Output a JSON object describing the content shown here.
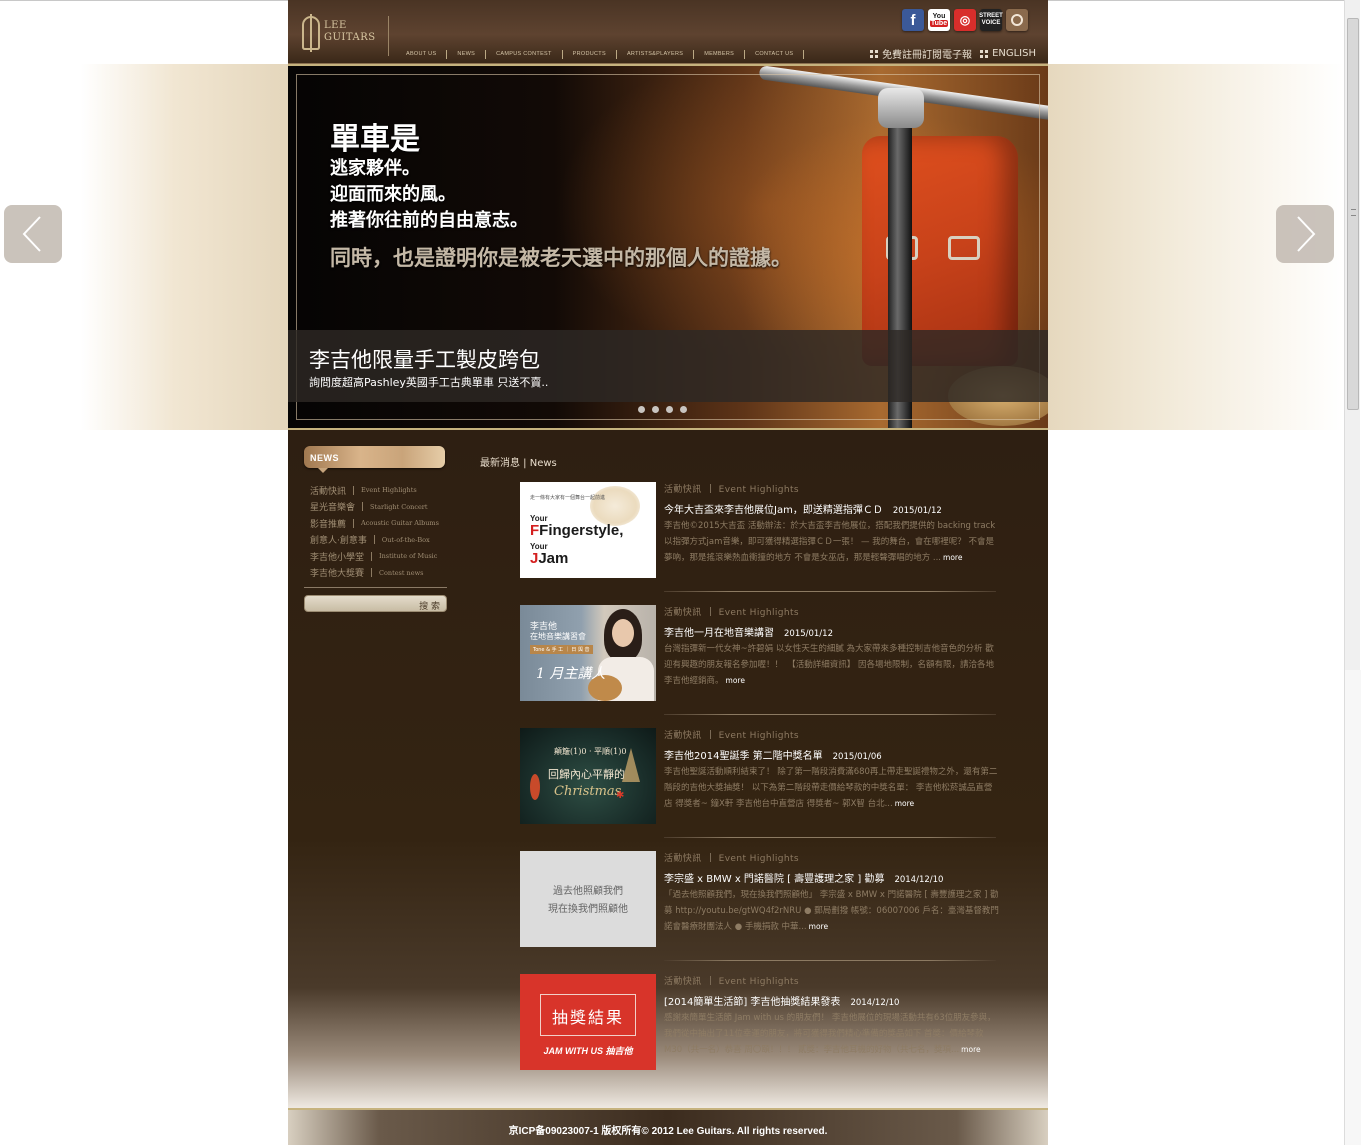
{
  "header": {
    "logo_text_line1": "LEE",
    "logo_text_line2": "GUITARS",
    "nav": [
      "ABOUT US",
      "NEWS",
      "CAMPUS CONTEST",
      "PRODUCTS",
      "ARTISTS&PLAYERS",
      "MEMBERS",
      "CONTACT US"
    ],
    "subscribe_label": "免費註冊訂閱電子報",
    "english_label": "ENGLISH",
    "social": [
      "facebook-icon",
      "youtube-icon",
      "weibo-icon",
      "streetvoice-icon",
      "instagram-icon"
    ],
    "youtube_label_1": "You",
    "youtube_label_2": "Tube",
    "streetvoice_label": "STREET VOICE"
  },
  "banner": {
    "line1": "單車是",
    "line2": "逃家夥伴。",
    "line3": "迎面而來的風。",
    "line4": "推著你往前的自由意志。",
    "line5": "同時，也是證明你是被老天選中的那個人的證據。",
    "caption_title": "李吉他限量手工製皮跨包",
    "caption_subtitle": "詢問度超高Pashley英國手工古典單車 只送不賣..",
    "slide_count": 4
  },
  "sidebar": {
    "tab_label": "NEWS",
    "items": [
      {
        "zh": "活動快訊",
        "en": "Event Highlights"
      },
      {
        "zh": "星光音樂會",
        "en": "Starlight Concert"
      },
      {
        "zh": "影音推薦",
        "en": "Acoustic Guitar Albums"
      },
      {
        "zh": "創意人‧創意事",
        "en": "Out-of-the-Box"
      },
      {
        "zh": "李吉他小學堂",
        "en": "Institute of Music"
      },
      {
        "zh": "李吉他大獎賽",
        "en": "Contest news"
      }
    ],
    "search_label": "搜 索"
  },
  "main": {
    "heading": "最新消息 | News",
    "more_label": "more",
    "items": [
      {
        "cat_zh": "活動快訊",
        "cat_en": "Event Highlights",
        "title": "今年大吉盃來李吉他展位Jam，即送精選指彈ＣＤ",
        "date": "2015/01/12",
        "body": "李吉他©2015大吉盃 活動辦法：於大吉盃李吉他展位，搭配我們提供的 backing track以指彈方式jam音樂，即可獲得精選指彈ＣＤ一張！ — 我的舞台，會在哪裡呢？ 不會是夢吶，那是搖滾樂熱血衝撞的地方 不會是女巫店，那是輕聲彈唱的地方 ...",
        "thumb": {
          "top": "走一條有大家有一個舞台一起前進",
          "your": "Your",
          "main1": "Fingerstyle,",
          "your2": "Your",
          "main2": "Jam"
        }
      },
      {
        "cat_zh": "活動快訊",
        "cat_en": "Event Highlights",
        "title": "李吉他一月在地音樂講習",
        "date": "2015/01/12",
        "body": "台灣指彈新一代女神~許碧娟 以女性天生的細膩 為大家帶來多種控制吉他音色的分析 歡迎有興趣的朋友報名參加喔！！　【活動詳細資訊】 因各場地限制，名額有限，請洽各地李吉他經銷商。",
        "thumb": {
          "a": "李吉他",
          "b": "在地音樂講習會",
          "c": "Tone & 手 工 ｜ 日 與 音",
          "d": "1 月主講人"
        }
      },
      {
        "cat_zh": "活動快訊",
        "cat_en": "Event Highlights",
        "title": "李吉他2014聖誕季 第二階中獎名單",
        "date": "2015/01/06",
        "body": "李吉他聖誕活動順利結束了！ 除了第一階段消費滿680再上帶走聖誕禮物之外，還有第二階段的吉他大獎抽獎！ 以下為第二階段帶走價給琴款的中獎名單： 李吉他松菸誠品直營店 得獎者~ 鐘X軒 李吉他台中直營店 得獎者~ 郭X智 台北...",
        "thumb": {
          "a": "顛簸(1)0 · 平順(1)0",
          "b": "回歸內心平靜的",
          "c": "Christmas"
        }
      },
      {
        "cat_zh": "活動快訊",
        "cat_en": "Event Highlights",
        "title": "李宗盛 x BMW x 門諾醫院 [ 壽豐護理之家 ] 勸募",
        "date": "2014/12/10",
        "body": "「過去他照顧我們，現在換我們照顧他」 李宗盛 x BMW x 門諾醫院 [ 壽豐護理之家 ] 勸募 http://youtu.be/gtWQ4f2rNRU ● 郵局劃撥 帳號：06007006 戶名：臺灣基督教門諾會醫療財團法人 ● 手機捐款 中華...",
        "thumb": {
          "a": "過去他照顧我們",
          "b": "現在換我們照顧他"
        }
      },
      {
        "cat_zh": "活動快訊",
        "cat_en": "Event Highlights",
        "title": "[2014簡單生活節] 李吉他抽獎結果發表",
        "date": "2014/12/10",
        "body": "感謝來簡單生活節 Jam with us 的朋友們！ 李吉他展位的現場活動共有63位朋友參與，我們從中抽出了11位幸運的朋友，將可獲得我們精心準備的獎品如下 首獎：價給琴款M30（共一名）恭喜 周〇頤！！！ 貳獎：李吉他耳機的好物（共七名，獎項...",
        "thumb": {
          "a": "抽獎結果",
          "b": "JAM WITH US 抽吉他"
        }
      }
    ]
  },
  "footer": {
    "text": "京ICP备09023007-1 版权所有© 2012 Lee Guitars. All rights reserved."
  }
}
